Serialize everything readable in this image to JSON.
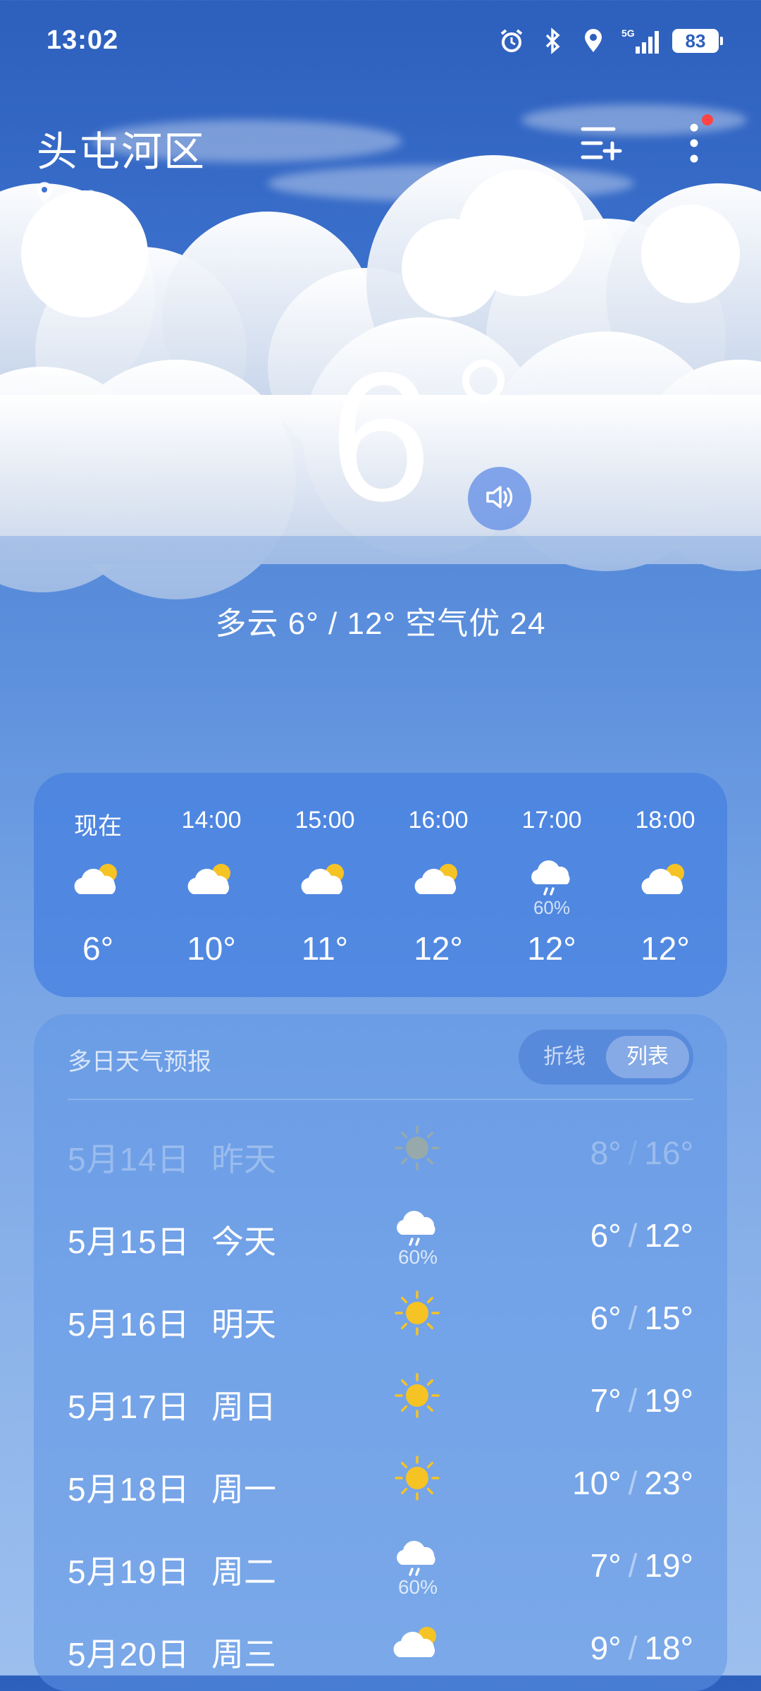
{
  "status_bar": {
    "time": "13:02",
    "network": "5G",
    "battery": "83"
  },
  "header": {
    "city": "头屯河区"
  },
  "current": {
    "temperature": "6",
    "summary": "多云 6° / 12° 空气优 24"
  },
  "hourly": [
    {
      "time": "现在",
      "icon": "partly-cloudy-icon",
      "temp": "6°",
      "prob": ""
    },
    {
      "time": "14:00",
      "icon": "partly-cloudy-icon",
      "temp": "10°",
      "prob": ""
    },
    {
      "time": "15:00",
      "icon": "partly-cloudy-icon",
      "temp": "11°",
      "prob": ""
    },
    {
      "time": "16:00",
      "icon": "partly-cloudy-icon",
      "temp": "12°",
      "prob": ""
    },
    {
      "time": "17:00",
      "icon": "rain-cloud-icon",
      "temp": "12°",
      "prob": "60%"
    },
    {
      "time": "18:00",
      "icon": "partly-cloudy-icon",
      "temp": "12°",
      "prob": ""
    }
  ],
  "daily": {
    "title": "多日天气预报",
    "toggle": {
      "chart": "折线",
      "list": "列表",
      "selected": "列表"
    },
    "days": [
      {
        "date": "5月14日",
        "label": "昨天",
        "icon": "sun-icon",
        "prob": "",
        "low": "8°",
        "high": "16°",
        "past": true
      },
      {
        "date": "5月15日",
        "label": "今天",
        "icon": "rain-cloud-icon",
        "prob": "60%",
        "low": "6°",
        "high": "12°",
        "past": false
      },
      {
        "date": "5月16日",
        "label": "明天",
        "icon": "sun-icon",
        "prob": "",
        "low": "6°",
        "high": "15°",
        "past": false
      },
      {
        "date": "5月17日",
        "label": "周日",
        "icon": "sun-icon",
        "prob": "",
        "low": "7°",
        "high": "19°",
        "past": false
      },
      {
        "date": "5月18日",
        "label": "周一",
        "icon": "sun-icon",
        "prob": "",
        "low": "10°",
        "high": "23°",
        "past": false
      },
      {
        "date": "5月19日",
        "label": "周二",
        "icon": "rain-cloud-icon",
        "prob": "60%",
        "low": "7°",
        "high": "19°",
        "past": false
      },
      {
        "date": "5月20日",
        "label": "周三",
        "icon": "partly-cloudy-icon",
        "prob": "",
        "low": "9°",
        "high": "18°",
        "past": false
      }
    ]
  },
  "colors": {
    "sky_top": "#2d5fbd",
    "sky_bottom": "#9cbfee",
    "sun": "#f6c325",
    "cloud": "#ffffff"
  }
}
